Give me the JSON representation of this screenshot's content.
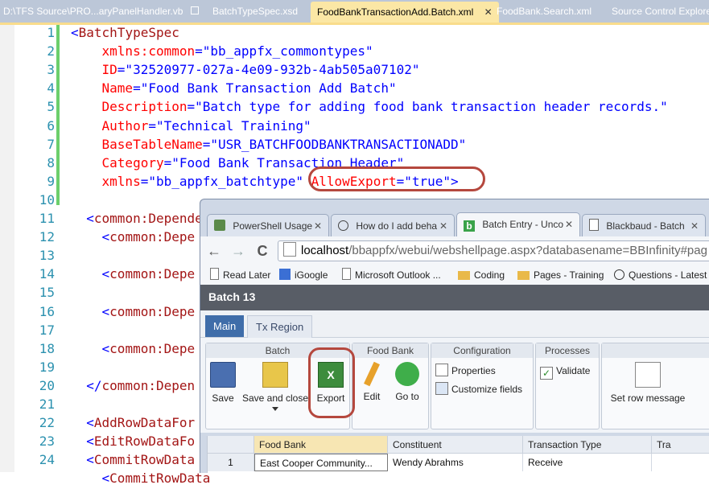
{
  "ide": {
    "tabs": [
      {
        "label": "D:\\TFS Source\\PRO...aryPanelHandler.vb",
        "locked": true
      },
      {
        "label": "BatchTypeSpec.xsd",
        "locked": false
      },
      {
        "label": "FoodBankTransactionAdd.Batch.xml",
        "active": true,
        "close": "✕"
      },
      {
        "label": "FoodBank.Search.xml"
      },
      {
        "label": "Source Control Explorer"
      }
    ],
    "lines": [
      {
        "n": "1",
        "parts": [
          {
            "t": "<",
            "c": "blue"
          },
          {
            "t": "BatchTypeSpec",
            "c": "brown"
          }
        ]
      },
      {
        "n": "2",
        "parts": [
          {
            "t": "    xmlns:common",
            "c": "red"
          },
          {
            "t": "=\"",
            "c": "blue"
          },
          {
            "t": "bb_appfx_commontypes",
            "c": "blue"
          },
          {
            "t": "\"",
            "c": "blue"
          }
        ]
      },
      {
        "n": "3",
        "parts": [
          {
            "t": "    ID",
            "c": "red"
          },
          {
            "t": "=\"",
            "c": "blue"
          },
          {
            "t": "32520977-027a-4e09-932b-4ab505a07102",
            "c": "blue"
          },
          {
            "t": "\"",
            "c": "blue"
          }
        ]
      },
      {
        "n": "4",
        "parts": [
          {
            "t": "    Name",
            "c": "red"
          },
          {
            "t": "=\"",
            "c": "blue"
          },
          {
            "t": "Food Bank Transaction Add Batch",
            "c": "blue"
          },
          {
            "t": "\"",
            "c": "blue"
          }
        ]
      },
      {
        "n": "5",
        "parts": [
          {
            "t": "    Description",
            "c": "red"
          },
          {
            "t": "=\"",
            "c": "blue"
          },
          {
            "t": "Batch type for adding food bank transaction header records.",
            "c": "blue"
          },
          {
            "t": "\"",
            "c": "blue"
          }
        ]
      },
      {
        "n": "6",
        "parts": [
          {
            "t": "    Author",
            "c": "red"
          },
          {
            "t": "=\"",
            "c": "blue"
          },
          {
            "t": "Technical Training",
            "c": "blue"
          },
          {
            "t": "\"",
            "c": "blue"
          }
        ]
      },
      {
        "n": "7",
        "parts": [
          {
            "t": "    BaseTableName",
            "c": "red"
          },
          {
            "t": "=\"",
            "c": "blue"
          },
          {
            "t": "USR_BATCHFOODBANKTRANSACTIONADD",
            "c": "blue"
          },
          {
            "t": "\"",
            "c": "blue"
          }
        ]
      },
      {
        "n": "8",
        "parts": [
          {
            "t": "    Category",
            "c": "red"
          },
          {
            "t": "=\"",
            "c": "blue"
          },
          {
            "t": "Food Bank Transaction Header",
            "c": "blue"
          },
          {
            "t": "\"",
            "c": "blue"
          }
        ]
      },
      {
        "n": "9",
        "parts": [
          {
            "t": "    xmlns",
            "c": "red"
          },
          {
            "t": "=\"",
            "c": "blue"
          },
          {
            "t": "bb_appfx_batchtype",
            "c": "blue"
          },
          {
            "t": "\" ",
            "c": "blue"
          },
          {
            "t": "AllowExport",
            "c": "red"
          },
          {
            "t": "=\"",
            "c": "blue"
          },
          {
            "t": "true",
            "c": "blue"
          },
          {
            "t": "\">",
            "c": "blue"
          }
        ]
      },
      {
        "n": "10",
        "parts": []
      },
      {
        "n": "11",
        "parts": [
          {
            "t": "  <",
            "c": "blue"
          },
          {
            "t": "common:Depende",
            "c": "brown"
          }
        ]
      },
      {
        "n": "12",
        "parts": [
          {
            "t": "    <",
            "c": "blue"
          },
          {
            "t": "common:Depe",
            "c": "brown"
          }
        ]
      },
      {
        "n": "13",
        "parts": []
      },
      {
        "n": "14",
        "parts": [
          {
            "t": "    <",
            "c": "blue"
          },
          {
            "t": "common:Depe",
            "c": "brown"
          }
        ]
      },
      {
        "n": "15",
        "parts": []
      },
      {
        "n": "16",
        "parts": [
          {
            "t": "    <",
            "c": "blue"
          },
          {
            "t": "common:Depe",
            "c": "brown"
          }
        ]
      },
      {
        "n": "17",
        "parts": []
      },
      {
        "n": "18",
        "parts": [
          {
            "t": "    <",
            "c": "blue"
          },
          {
            "t": "common:Depe",
            "c": "brown"
          }
        ]
      },
      {
        "n": "19",
        "parts": []
      },
      {
        "n": "20",
        "parts": [
          {
            "t": "  </",
            "c": "blue"
          },
          {
            "t": "common:Depen",
            "c": "brown"
          }
        ]
      },
      {
        "n": "21",
        "parts": []
      },
      {
        "n": "22",
        "parts": [
          {
            "t": "  <",
            "c": "blue"
          },
          {
            "t": "AddRowDataFor",
            "c": "brown"
          }
        ]
      },
      {
        "n": "23",
        "parts": [
          {
            "t": "  <",
            "c": "blue"
          },
          {
            "t": "EditRowDataFo",
            "c": "brown"
          }
        ]
      },
      {
        "n": "24",
        "parts": [
          {
            "t": "  <",
            "c": "blue"
          },
          {
            "t": "CommitRowData",
            "c": "brown"
          }
        ]
      },
      {
        "n": "",
        "parts": [
          {
            "t": "    <",
            "c": "blue"
          },
          {
            "t": "CommitRowData",
            "c": "brown"
          }
        ]
      }
    ]
  },
  "browser": {
    "tabs": [
      {
        "label": "PowerShell Usage",
        "icon": "powershell-icon"
      },
      {
        "label": "How do I add beha",
        "icon": "block-icon"
      },
      {
        "label": "Batch Entry - Unco",
        "icon": "b-logo-icon",
        "active": true
      },
      {
        "label": "Blackbaud - Batch",
        "icon": "page-icon"
      }
    ],
    "tab_close": "✕",
    "nav": {
      "back": "←",
      "forward": "→",
      "refresh": "C"
    },
    "url": {
      "host": "localhost",
      "rest": "/bbappfx/webui/webshellpage.aspx?databasename=BBInfinity#pag"
    },
    "bookmarks": [
      {
        "label": "Read Later",
        "icon": "page-icon"
      },
      {
        "label": "iGoogle",
        "icon": "google-icon"
      },
      {
        "label": "Microsoft Outlook ...",
        "icon": "page-icon"
      },
      {
        "label": "Coding",
        "icon": "folder-icon"
      },
      {
        "label": "Pages - Training",
        "icon": "folder-icon"
      },
      {
        "label": "Questions - Latest",
        "icon": "block-icon"
      }
    ],
    "page_title": "Batch 13",
    "subtabs": [
      "Main",
      "Tx Region"
    ],
    "ribbon": {
      "groups": {
        "batch": "Batch",
        "food_bank": "Food Bank",
        "configuration": "Configuration",
        "processes": "Processes"
      },
      "save": "Save",
      "save_close": "Save and close",
      "export": "Export",
      "edit": "Edit",
      "goto": "Go to",
      "properties": "Properties",
      "customize": "Customize fields",
      "validate": "Validate",
      "set_row_message": "Set row message"
    },
    "grid": {
      "headers": [
        "",
        "Food Bank",
        "Constituent",
        "Transaction Type",
        "Tra"
      ],
      "row": [
        "1",
        "East Cooper Community...",
        "Wendy Abrahms",
        "Receive",
        ""
      ]
    }
  },
  "colors": {
    "accent_tab": "#3f6da9",
    "callout": "#b5483e",
    "ide_active_tab": "#fbe7a5"
  }
}
